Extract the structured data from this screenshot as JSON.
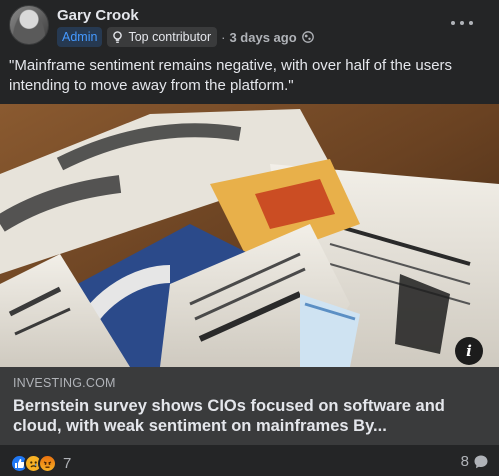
{
  "post": {
    "author": "Gary Crook",
    "badges": {
      "admin": "Admin",
      "top_contributor": "Top contributor"
    },
    "separator": "·",
    "time": "3 days ago",
    "text": "\"Mainframe sentiment remains negative, with over half of the users intending to move away from the platform.\""
  },
  "link_preview": {
    "domain": "INVESTING.COM",
    "title": "Bernstein survey shows CIOs focused on software and cloud, with weak sentiment on mainframes By..."
  },
  "footer": {
    "reaction_count": "7",
    "comment_count": "8"
  },
  "colors": {
    "background": "#242526",
    "link_box": "#3a3b3c",
    "admin_badge_text": "#4599ff",
    "like_blue": "#2078f4",
    "sad_yellow": "#f7b125"
  },
  "icons": [
    "more-options-icon",
    "top-contributor-icon",
    "globe-icon",
    "info-icon",
    "like-reaction-icon",
    "sad-reaction-icon",
    "angry-reaction-icon",
    "comment-icon"
  ]
}
